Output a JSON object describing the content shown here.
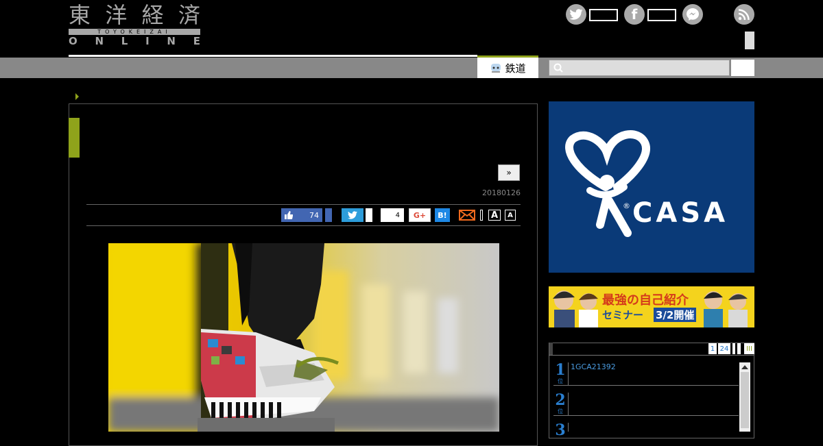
{
  "header": {
    "logo_kanji": [
      "東",
      "洋",
      "経",
      "済"
    ],
    "logo_sub": "TOYOKEIZAI",
    "logo_online": [
      "O",
      "N",
      "L",
      "I",
      "N",
      "E"
    ],
    "social": [
      {
        "icon": "twitter-icon",
        "glyph": "🐦"
      },
      {
        "icon": "facebook-icon",
        "glyph": "f"
      },
      {
        "icon": "messenger-icon",
        "glyph": "⚡"
      },
      {
        "icon": "rss-icon",
        "glyph": "◉"
      }
    ]
  },
  "nav": {
    "tab_label": "鉄道",
    "search_placeholder": ""
  },
  "article": {
    "next_label": "»",
    "date": "20180126",
    "share": {
      "like_count": "74",
      "comment_count": "4",
      "gplus_label": "G+",
      "hatena_label": "B!",
      "font_large": "A",
      "font_small": "A"
    }
  },
  "sidebar": {
    "casa_label": "CASA",
    "banner_text_1": "最強の自己紹介",
    "banner_text_2": "セミナー",
    "banner_text_3": "3/2開催",
    "ranking_tabs": [
      "1",
      "24",
      "",
      "",
      "III"
    ],
    "ranking": [
      {
        "num": "1",
        "unit": "位",
        "title": "1GCA21392"
      },
      {
        "num": "2",
        "unit": "位",
        "title": ""
      },
      {
        "num": "3",
        "unit": "位",
        "title": ""
      }
    ]
  },
  "colors": {
    "accent_green": "#8fa31b",
    "casa_blue": "#0a3a78",
    "facebook_blue": "#4266b2",
    "twitter_blue": "#2d9ddb"
  }
}
